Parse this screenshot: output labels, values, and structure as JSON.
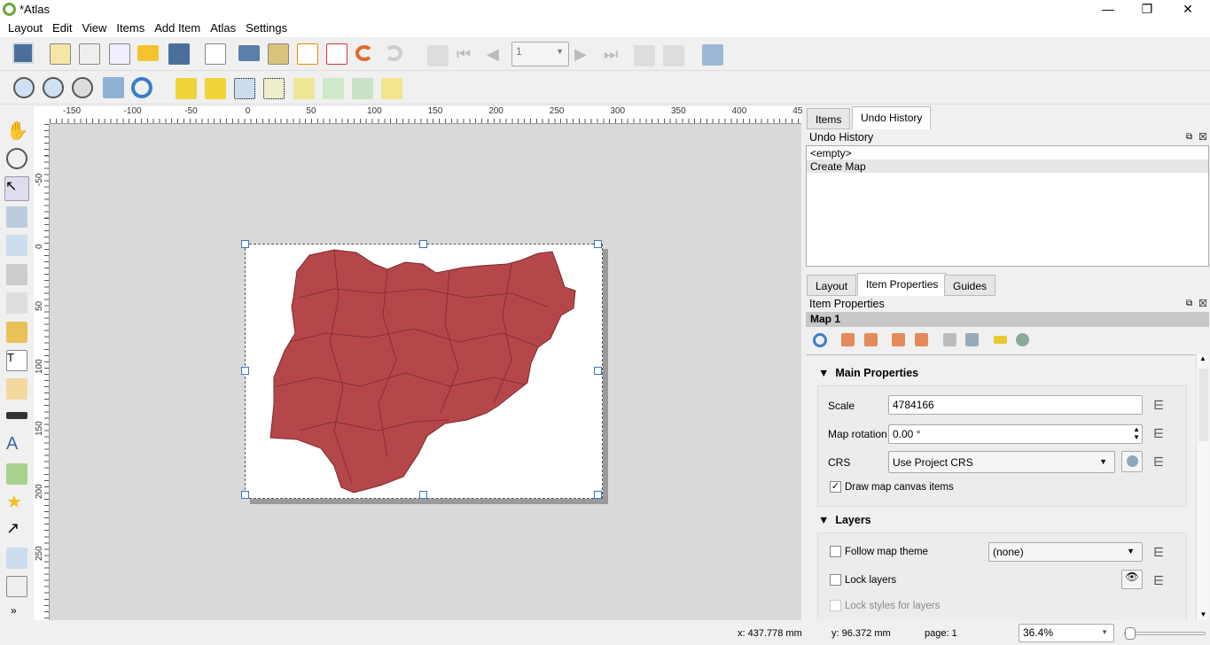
{
  "window": {
    "title": "*Atlas",
    "minimize": "—",
    "maximize": "❐",
    "close": "✕"
  },
  "menu": [
    "Layout",
    "Edit",
    "View",
    "Items",
    "Add Item",
    "Atlas",
    "Settings"
  ],
  "toolbar": {
    "page_number": "1"
  },
  "ruler_h": [
    "-150",
    "-100",
    "-50",
    "0",
    "50",
    "100",
    "150",
    "200",
    "250",
    "300",
    "350",
    "400",
    "45"
  ],
  "ruler_v": [
    "-50",
    "0",
    "50",
    "100",
    "150",
    "200",
    "250"
  ],
  "colors": {
    "map_fill": "#b5474b",
    "map_border": "#7a2a2e",
    "selection": "#3a77c7"
  },
  "top_tabs": [
    "Items",
    "Undo History"
  ],
  "undo": {
    "title": "Undo History",
    "items": [
      "<empty>",
      "Create Map"
    ]
  },
  "bottom_tabs": [
    "Layout",
    "Item Properties",
    "Guides"
  ],
  "props": {
    "title": "Item Properties",
    "item_name": "Map 1",
    "main_section": "Main Properties",
    "scale_label": "Scale",
    "scale_value": "4784166",
    "rotation_label": "Map rotation",
    "rotation_value": "0.00 °",
    "crs_label": "CRS",
    "crs_value": "Use Project CRS",
    "draw_canvas_label": "Draw map canvas items",
    "draw_canvas_checked": true,
    "layers_section": "Layers",
    "follow_theme_label": "Follow map theme",
    "follow_theme_value": "(none)",
    "lock_layers_label": "Lock layers",
    "lock_styles_label": "Lock styles for layers"
  },
  "status": {
    "x": "x: 437.778 mm",
    "y": "y: 96.372 mm",
    "page": "page: 1",
    "zoom": "36.4%"
  }
}
